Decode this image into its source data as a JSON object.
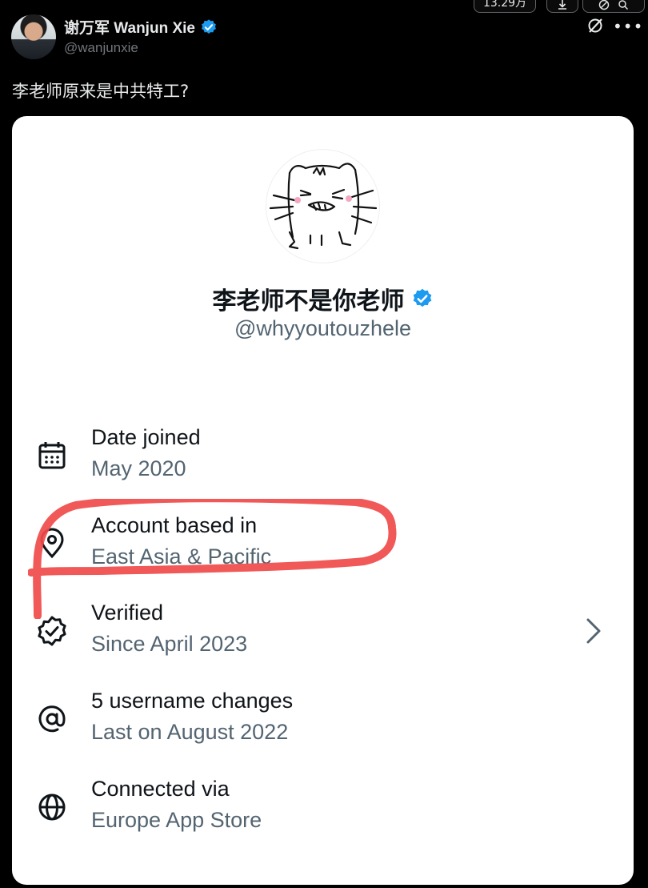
{
  "toolbar": {
    "views": "13.29万",
    "save_icon": "download-icon",
    "more_icons": [
      "edit-icon",
      "search-icon"
    ]
  },
  "tweet": {
    "display_name": "谢万军 Wanjun Xie",
    "handle": "@wanjunxie",
    "verified_icon": "verified-badge-icon",
    "grok_icon": "grok-icon",
    "more_icon": "more-dots-icon",
    "text": "李老师原来是中共特工?"
  },
  "card": {
    "profile": {
      "avatar_icon": "cat-drawing-avatar",
      "name": "李老师不是你老师",
      "handle": "@whyyoutouzhele"
    },
    "rows": [
      {
        "icon": "calendar-icon",
        "title": "Date joined",
        "sub": "May 2020"
      },
      {
        "icon": "location-pin-icon",
        "title": "Account based in",
        "sub": "East Asia & Pacific"
      },
      {
        "icon": "verified-check-icon",
        "title": "Verified",
        "sub": "Since April 2023",
        "chevron": true
      },
      {
        "icon": "at-sign-icon",
        "title": "5 username changes",
        "sub": "Last on August 2022"
      },
      {
        "icon": "globe-icon",
        "title": "Connected via",
        "sub": "Europe App Store"
      }
    ],
    "annotation_color": "#f04a4a"
  },
  "colors": {
    "background": "#000000",
    "verified_blue": "#1d9bf0",
    "secondary_text": "#71767b",
    "card_secondary_text": "#536471"
  }
}
